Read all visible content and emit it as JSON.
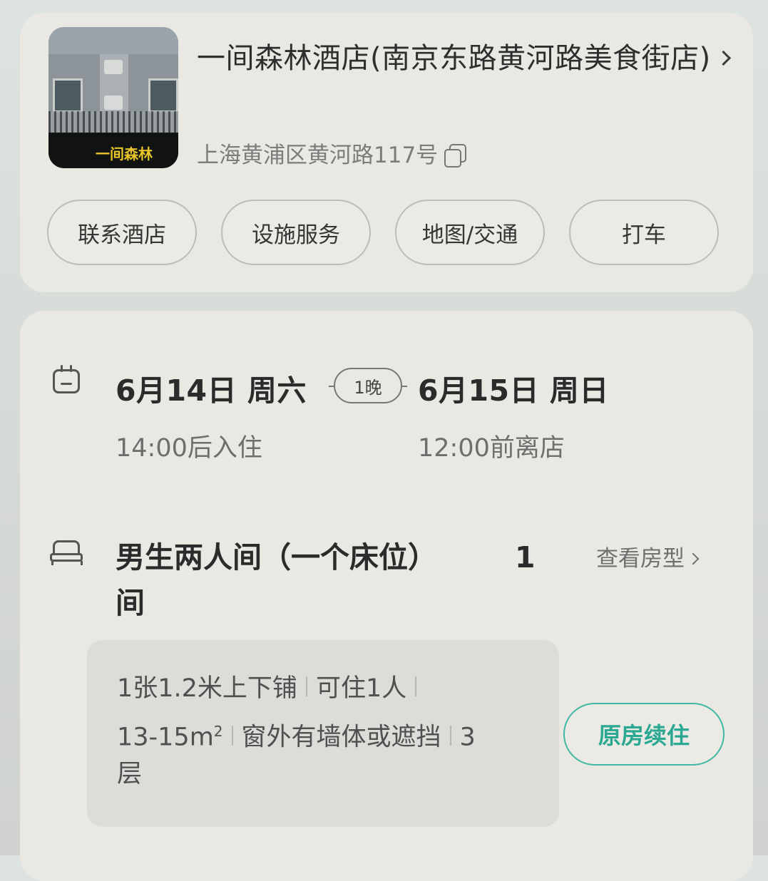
{
  "hotel": {
    "name": "一间森林酒店(南京东路黄河路美食街店)",
    "address": "上海黄浦区黄河路117号",
    "thumbnail_sign": "一间森林",
    "actions": [
      "联系酒店",
      "设施服务",
      "地图/交通",
      "打车"
    ]
  },
  "stay": {
    "checkin_date": "6月14日 周六",
    "nights": "1晚",
    "checkout_date": "6月15日 周日",
    "checkin_time": "14:00后入住",
    "checkout_time": "12:00前离店"
  },
  "room": {
    "name": "男生两人间（一个床位）",
    "count": "1",
    "count_unit": "间",
    "view_label": "查看房型",
    "bed": "1张1.2米上下铺",
    "occupancy": "可住1人",
    "area": "13-15m",
    "area_sup": "2",
    "window": "窗外有墙体或遮挡",
    "floor_num": "3",
    "floor_unit": "层",
    "renew_label": "原房续住"
  },
  "colors": {
    "accent": "#2aa892",
    "card": "#e9e8e3",
    "background": "#d7dbd8"
  }
}
